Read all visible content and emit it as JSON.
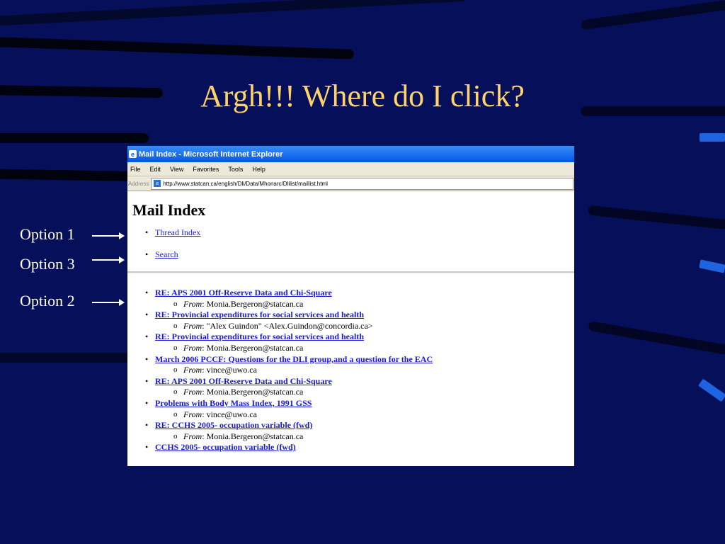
{
  "slide": {
    "title": "Argh!!!  Where do I click?"
  },
  "options": [
    {
      "label": "Option 1"
    },
    {
      "label": "Option 3"
    },
    {
      "label": "Option 2"
    }
  ],
  "browser": {
    "window_title": "Mail Index - Microsoft Internet Explorer",
    "menu": [
      "File",
      "Edit",
      "View",
      "Favorites",
      "Tools",
      "Help"
    ],
    "address_label": "Address",
    "url": "http://www.statcan.ca/english/Dli/Data/Mhonarc/Dlilist/maillist.html"
  },
  "page": {
    "heading": "Mail Index",
    "nav_links": [
      {
        "label": "Thread Index"
      },
      {
        "label": "Search"
      }
    ],
    "messages": [
      {
        "subject": "RE: APS 2001 Off-Reserve Data and Chi-Square",
        "from_label": "From",
        "from": ": Monia.Bergeron@statcan.ca"
      },
      {
        "subject": "RE: Provincial expenditures for social services and health",
        "from_label": "From",
        "from": ": \"Alex Guindon\" <Alex.Guindon@concordia.ca>"
      },
      {
        "subject": "RE: Provincial expenditures for social services and health",
        "from_label": "From",
        "from": ": Monia.Bergeron@statcan.ca"
      },
      {
        "subject": "March 2006 PCCF: Questions for the DLI group,and a question for the EAC",
        "from_label": "From",
        "from": ": vince@uwo.ca"
      },
      {
        "subject": "RE: APS 2001 Off-Reserve Data and Chi-Square",
        "from_label": "From",
        "from": ": Monia.Bergeron@statcan.ca"
      },
      {
        "subject": "Problems with Body Mass Index, 1991 GSS",
        "from_label": "From",
        "from": ": vince@uwo.ca"
      },
      {
        "subject": "RE: CCHS 2005- occupation variable (fwd)",
        "from_label": "From",
        "from": ": Monia.Bergeron@statcan.ca"
      },
      {
        "subject": "CCHS 2005- occupation variable (fwd)"
      }
    ]
  }
}
